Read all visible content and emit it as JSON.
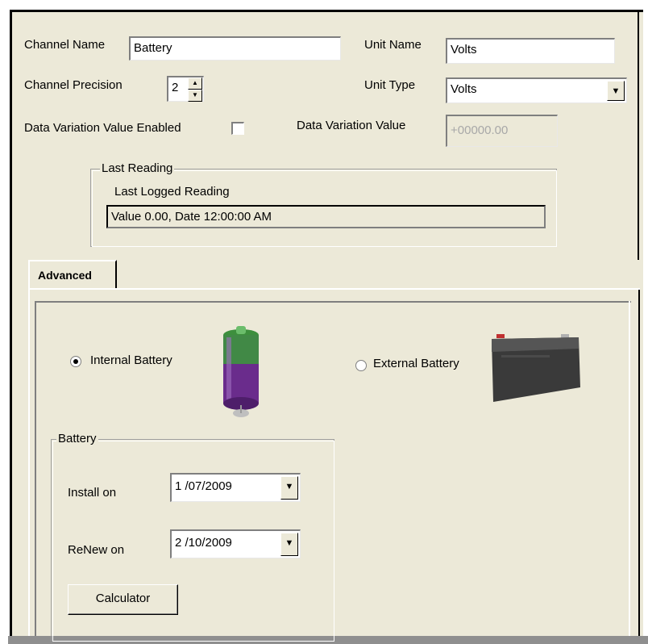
{
  "channel": {
    "name_label": "Channel Name",
    "name_value": "Battery",
    "precision_label": "Channel Precision",
    "precision_value": "2",
    "data_variation_enabled_label": "Data Variation Value Enabled",
    "data_variation_enabled_checked": false
  },
  "unit": {
    "name_label": "Unit Name",
    "name_value": "Volts",
    "type_label": "Unit Type",
    "type_value": "Volts",
    "data_variation_label": "Data Variation Value",
    "data_variation_value": "+00000.00"
  },
  "last_reading": {
    "group_label": "Last Reading",
    "caption": "Last Logged Reading",
    "value": "Value 0.00,  Date 12:00:00 AM"
  },
  "tabs": [
    {
      "label": "Advanced",
      "active": true
    }
  ],
  "advanced": {
    "internal_battery_label": "Internal Battery",
    "internal_battery_selected": true,
    "external_battery_label": "External Battery",
    "external_battery_selected": false,
    "battery_group_label": "Battery",
    "install_on_label": "Install on",
    "install_on_value": "1 /07/2009",
    "renew_on_label": "ReNew on",
    "renew_on_value": "2 /10/2009",
    "calculator_label": "Calculator"
  },
  "icons": {
    "spin_up": "spin-up-arrow",
    "spin_down": "spin-down-arrow",
    "dropdown": "dropdown-arrow",
    "internal_battery_image": "cylindrical-battery",
    "external_battery_image": "sealed-lead-acid-battery"
  },
  "colors": {
    "window_background": "#ece9d8",
    "field_background": "#ffffff",
    "disabled_text": "#a8a8a8",
    "cell_battery_purple": "#6a2c8c",
    "cell_battery_green": "#3a9a3a",
    "lead_acid_battery": "#3a3a3a"
  }
}
